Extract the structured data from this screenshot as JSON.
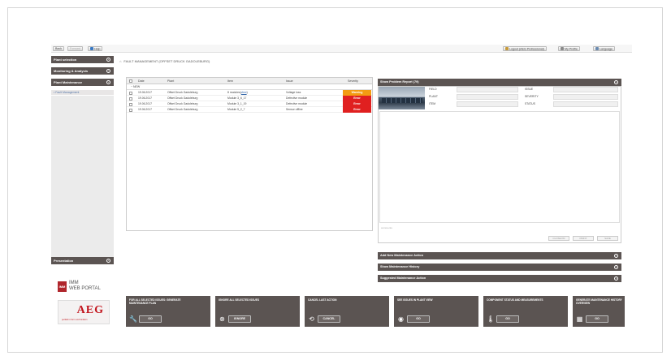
{
  "toolbar": {
    "back_label": "Back",
    "forward_label": "Forward",
    "help_label": "Help",
    "logout_label": "Logout (AEG Professional)",
    "profile_label": "My Profile",
    "language_label": "Language"
  },
  "sidebar": {
    "sections": [
      {
        "label": "Plant selection"
      },
      {
        "label": "Monitoring & Analysis"
      },
      {
        "label": "Plant Maintenance"
      }
    ],
    "active_item": "Fault Management",
    "presentation_label": "Presentation",
    "imm_logo_box": "IMM",
    "imm_line1": "IMM",
    "imm_line2": "WEB PORTAL",
    "aeg_brand": "AEG",
    "aeg_tagline": "perfekt in form und funktion"
  },
  "breadcrumb": {
    "text": "FAULT MANAGEMENT (OFFSET DRUCK GADOLEBURG)"
  },
  "fault_table": {
    "columns": [
      "Date",
      "Plant",
      "Item",
      "Issue",
      "Severity"
    ],
    "group_label": "NEW",
    "rows": [
      {
        "date": "19.06.2017",
        "plant": "Offset Druck Gadoleburg",
        "item_prefix": "8 modules(",
        "item_link": "view",
        "item_suffix": ")",
        "issue": "Voltage loss",
        "severity": "Warning",
        "severity_color": "#f39c12"
      },
      {
        "date": "19.06.2017",
        "plant": "Offset Druck Gadoleburg",
        "item": "Module 3_6_17",
        "issue": "Defective module",
        "severity": "Error",
        "severity_color": "#e02020"
      },
      {
        "date": "19.06.2017",
        "plant": "Offset Druck Gadoleburg",
        "item": "Module 3_1_19",
        "issue": "Defective module",
        "severity": "Error",
        "severity_color": "#e02020"
      },
      {
        "date": "19.06.2017",
        "plant": "Offset Druck Gadoleburg",
        "item": "Module 5_2_7",
        "issue": "Sensor offline",
        "severity": "Error",
        "severity_color": "#e02020"
      }
    ]
  },
  "report": {
    "title": "Show Problem Report (79)",
    "fields_left": [
      "FIELD",
      "PLANT",
      "ITEM"
    ],
    "fields_right": [
      "ISSUE",
      "SEVERITY",
      "STATUS"
    ],
    "comment_placeholder": "comments",
    "btn_close": "CLOSE PR",
    "btn_print": "PRINT",
    "btn_save": "SAVE"
  },
  "panels": [
    {
      "label": "Add New Maintenance Action"
    },
    {
      "label": "Show Maintenance History"
    },
    {
      "label": "Suggested Maintenance Action"
    }
  ],
  "actions": [
    {
      "label": "For all selected issues: Generate Maintenance Plan",
      "button": "GO",
      "icon": "wrench-icon",
      "glyph": "🔧"
    },
    {
      "label": "Ignore all selected issues",
      "button": "IGNORE",
      "icon": "ignore-icon",
      "glyph": "⊗"
    },
    {
      "label": "Cancel last action",
      "button": "CANCEL",
      "icon": "undo-icon",
      "glyph": "⟲"
    },
    {
      "label": "See issues in plant view",
      "button": "GO",
      "icon": "eye-icon",
      "glyph": "◉"
    },
    {
      "label": "Component status and measurements",
      "button": "GO",
      "icon": "thermometer-icon",
      "glyph": "🌡"
    },
    {
      "label": "Generate maintenance history overview",
      "button": "GO",
      "icon": "calendar-icon",
      "glyph": "▦"
    }
  ],
  "colors": {
    "header_dark": "#5b5452",
    "warning": "#f39c12",
    "error": "#e02020",
    "aeg_red": "#c2151d"
  }
}
